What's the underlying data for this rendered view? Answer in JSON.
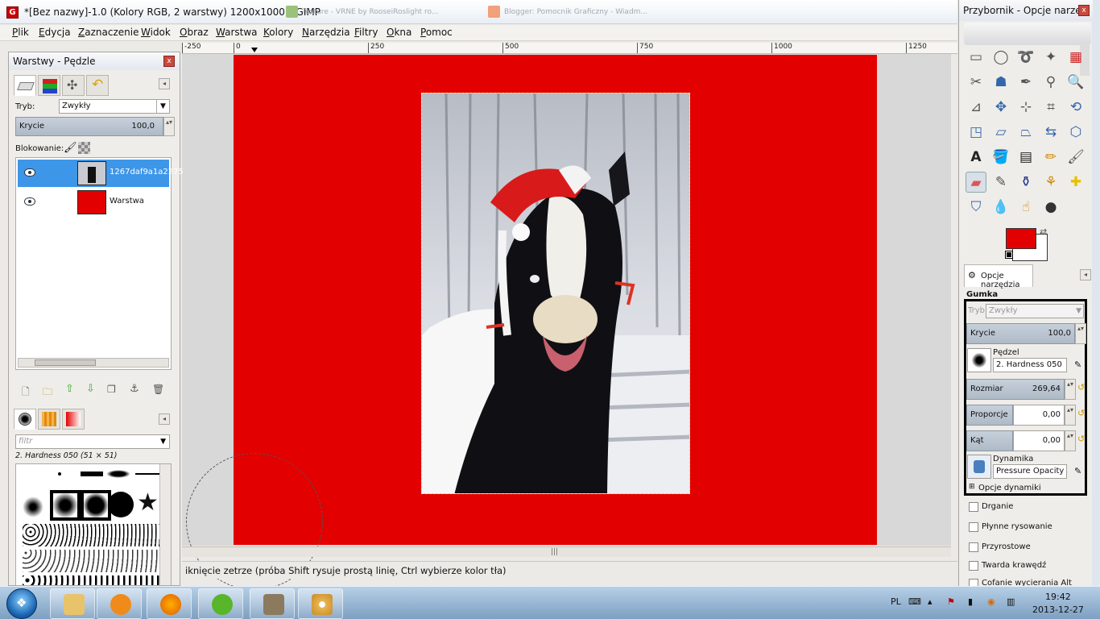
{
  "window": {
    "title": "*[Bez nazwy]-1.0 (Kolory RGB, 2 warstwy) 1200x1000 – GIMP",
    "background_tabs": [
      "Texture - VRNE by RooseiRoslight ro...",
      "Blogger: Pomocnik Graficzny - Wiadm..."
    ]
  },
  "menu": [
    "Plik",
    "Edycja",
    "Zaznaczenie",
    "Widok",
    "Obraz",
    "Warstwa",
    "Kolory",
    "Narzędzia",
    "Filtry",
    "Okna",
    "Pomoc"
  ],
  "ruler": {
    "ticks": [
      "-250",
      "0",
      "250",
      "500",
      "750",
      "1000",
      "1250"
    ]
  },
  "status": {
    "text": "iknięcie zetrze (próba Shift rysuje prostą linię, Ctrl wybierze kolor tła)"
  },
  "layers_dock": {
    "title": "Warstwy - Pędzle",
    "mode_label": "Tryb:",
    "mode_value": "Zwykły",
    "opacity_label": "Krycie",
    "opacity_value": "100,0",
    "lock_label": "Blokowanie:",
    "layers": [
      {
        "name": "1267daf9a1a2275",
        "selected": true
      },
      {
        "name": "Warstwa",
        "selected": false
      }
    ],
    "brush_filter_placeholder": "filtr",
    "brush_name": "2. Hardness 050 (51 × 51)"
  },
  "toolbox": {
    "title": "Przybornik - Opcje narzę...",
    "fg_color": "#e20000",
    "bg_color": "#ffffff",
    "options_tab": "Opcje narzędzia",
    "tool_name": "Gumka",
    "mode_label": "Tryb:",
    "mode_value": "Zwykły",
    "opacity_label": "Krycie",
    "opacity_value": "100,0",
    "brush_label": "Pędzel",
    "brush_value": "2. Hardness 050",
    "size_label": "Rozmiar",
    "size_value": "269,64",
    "aspect_label": "Proporcje",
    "aspect_value": "0,00",
    "angle_label": "Kąt",
    "angle_value": "0,00",
    "dynamics_label": "Dynamika",
    "dynamics_value": "Pressure Opacity",
    "dynamics_options": "Opcje dynamiki",
    "checkboxes": [
      "Drganie",
      "Płynne rysowanie",
      "Przyrostowe",
      "Twarda krawędź",
      "Cofanie wycierania  Alt"
    ]
  },
  "taskbar": {
    "lang": "PL",
    "time": "19:42",
    "date": "2013-12-27"
  }
}
